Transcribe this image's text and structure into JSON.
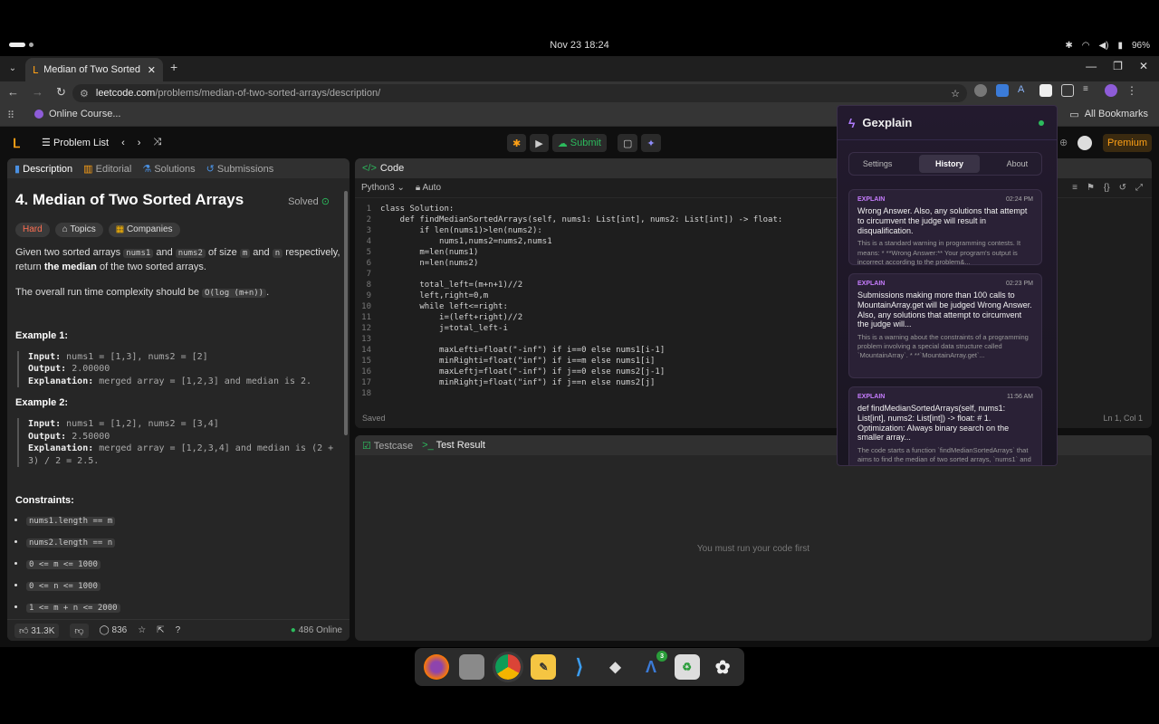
{
  "system": {
    "datetime": "Nov 23  18:24",
    "battery": "96%"
  },
  "browser": {
    "tab_title": "Median of Two Sorted A",
    "url_host": "leetcode.com",
    "url_path": "/problems/median-of-two-sorted-arrays/description/",
    "bookmark": "Online Course...",
    "all_bookmarks": "All Bookmarks"
  },
  "header": {
    "problem_list": "Problem List",
    "submit": "Submit",
    "premium": "Premium"
  },
  "left_panel": {
    "tabs": [
      "Description",
      "Editorial",
      "Solutions",
      "Submissions"
    ],
    "title": "4. Median of Two Sorted Arrays",
    "solved": "Solved",
    "tags": [
      "Hard",
      "Topics",
      "Companies"
    ],
    "desc_a": "Given two sorted arrays",
    "code_nums1": "nums1",
    "desc_b": "and",
    "code_nums2": "nums2",
    "desc_c": "of size",
    "code_m": "m",
    "desc_d": "and",
    "code_n": "n",
    "desc_e": "respectively, return",
    "desc_bold": "the median",
    "desc_f": "of the two sorted arrays.",
    "runtime_text": "The overall run time complexity should be",
    "runtime_code": "O(log (m+n))",
    "runtime_end": ".",
    "example1_title": "Example 1:",
    "example1": {
      "input_label": "Input:",
      "input": "nums1 = [1,3], nums2 = [2]",
      "output_label": "Output:",
      "output": "2.00000",
      "expl_label": "Explanation:",
      "expl": "merged array = [1,2,3] and median is 2."
    },
    "example2_title": "Example 2:",
    "example2": {
      "input_label": "Input:",
      "input": "nums1 = [1,2], nums2 = [3,4]",
      "output_label": "Output:",
      "output": "2.50000",
      "expl_label": "Explanation:",
      "expl": "merged array = [1,2,3,4] and median is (2 + 3) / 2 = 2.5."
    },
    "constraints_title": "Constraints:",
    "constraints": [
      "nums1.length == m",
      "nums2.length == n",
      "0 <= m <= 1000",
      "0 <= n <= 1000",
      "1 <= m + n <= 2000"
    ],
    "likes": "31.3K",
    "comments": "836",
    "online": "486 Online"
  },
  "code_panel": {
    "title": "Code",
    "language": "Python3",
    "auto": "Auto",
    "lines": [
      "class Solution:",
      "    def findMedianSortedArrays(self, nums1: List[int], nums2: List[int]) -> float:",
      "        if len(nums1)>len(nums2):",
      "            nums1,nums2=nums2,nums1",
      "        m=len(nums1)",
      "        n=len(nums2)",
      "",
      "        total_left=(m+n+1)//2",
      "        left,right=0,m",
      "        while left<=right:",
      "            i=(left+right)//2",
      "            j=total_left-i",
      "",
      "            maxLefti=float(\"-inf\") if i==0 else nums1[i-1]",
      "            minRighti=float(\"inf\") if i==m else nums1[i]",
      "            maxLeftj=float(\"-inf\") if j==0 else nums2[j-1]",
      "            minRightj=float(\"inf\") if j==n else nums2[j]",
      ""
    ],
    "line_numbers": [
      "1",
      "2",
      "3",
      "4",
      "5",
      "6",
      "7",
      "8",
      "9",
      "10",
      "11",
      "12",
      "13",
      "14",
      "15",
      "16",
      "17",
      "18"
    ],
    "saved": "Saved",
    "cursor": "Ln 1, Col 1"
  },
  "test_panel": {
    "tab1": "Testcase",
    "tab2": "Test Result",
    "message": "You must run your code first"
  },
  "gexplain": {
    "title": "Gexplain",
    "tabs": [
      "Settings",
      "History",
      "About"
    ],
    "cards": [
      {
        "label": "EXPLAIN",
        "time": "02:24 PM",
        "question": "Wrong Answer. Also, any solutions that attempt to circumvent the judge will result in disqualification.",
        "answer": "This is a standard warning in programming contests. It means: * **Wrong Answer:** Your program's output is incorrect according to the problem&..."
      },
      {
        "label": "EXPLAIN",
        "time": "02:23 PM",
        "question": "Submissions making more than 100 calls to MountainArray.get will be judged Wrong Answer. Also, any solutions that attempt to circumvent the judge will...",
        "answer": "This is a warning about the constraints of a programming problem involving a special data structure called `MountainArray`. * **`MountainArray.get`..."
      },
      {
        "label": "EXPLAIN",
        "time": "11:56 AM",
        "question": "def findMedianSortedArrays(self, nums1: List[int], nums2: List[int]) -> float: # 1. Optimization: Always binary search on the smaller array...",
        "answer": "The code starts a function `findMedianSortedArrays` that aims to find the median of two sorted arrays, `nums1` and `nums2`. It first optimizes by ens..."
      }
    ]
  },
  "dock": {
    "badge": "3"
  }
}
